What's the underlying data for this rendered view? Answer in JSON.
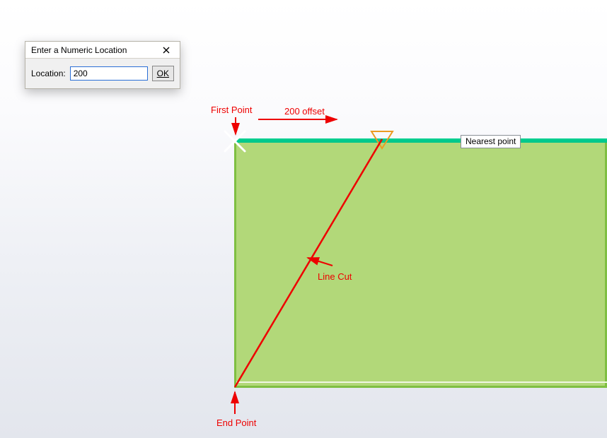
{
  "dialog": {
    "title": "Enter a Numeric Location",
    "location_label": "Location:",
    "location_value": "200",
    "ok_label": "OK"
  },
  "labels": {
    "first_point": "First Point",
    "offset": "200 offset",
    "nearest": "Nearest point",
    "line_cut": "Line Cut",
    "end_point": "End Point"
  }
}
